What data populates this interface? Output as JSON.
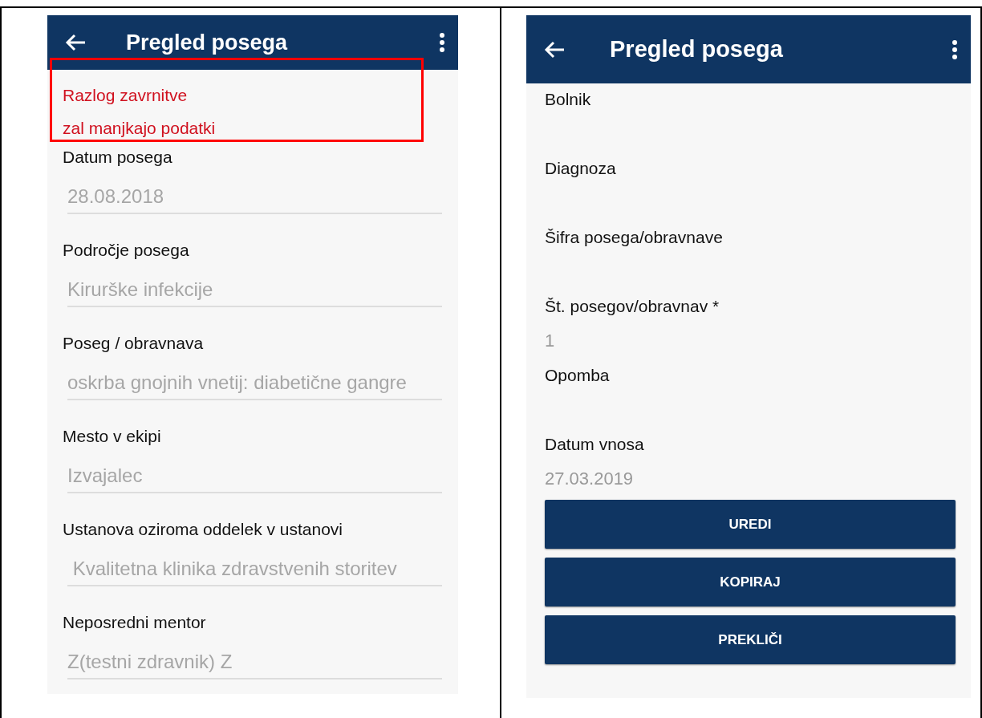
{
  "screens": [
    {
      "title": "Pregled posega",
      "reason": {
        "highlighted": true,
        "label": "Razlog zavrnitve",
        "value": "zal manjkajo podatki"
      },
      "fields": [
        {
          "label": "Datum posega",
          "value": "28.08.2018"
        },
        {
          "label": "Področje posega",
          "value": "Kirurške infekcije"
        },
        {
          "label": "Poseg / obravnava",
          "value": "oskrba gnojnih vnetij: diabetične gangre"
        },
        {
          "label": "Mesto v ekipi",
          "value": "Izvajalec"
        },
        {
          "label": "Ustanova oziroma oddelek v ustanovi",
          "value": " Kvalitetna klinika zdravstvenih storitev"
        },
        {
          "label": "Neposredni mentor",
          "value": "Z(testni zdravnik) Z"
        }
      ]
    },
    {
      "title": "Pregled posega",
      "fields": [
        {
          "label": "Bolnik"
        },
        {
          "label": "Diagnoza"
        },
        {
          "label": "Šifra posega/obravnave"
        },
        {
          "label": "Št. posegov/obravnav *",
          "value": "1"
        },
        {
          "label": "Opomba"
        },
        {
          "label": "Datum vnosa",
          "value": "27.03.2019"
        }
      ],
      "buttons": [
        "UREDI",
        "KOPIRAJ",
        "PREKLIČI"
      ]
    }
  ]
}
